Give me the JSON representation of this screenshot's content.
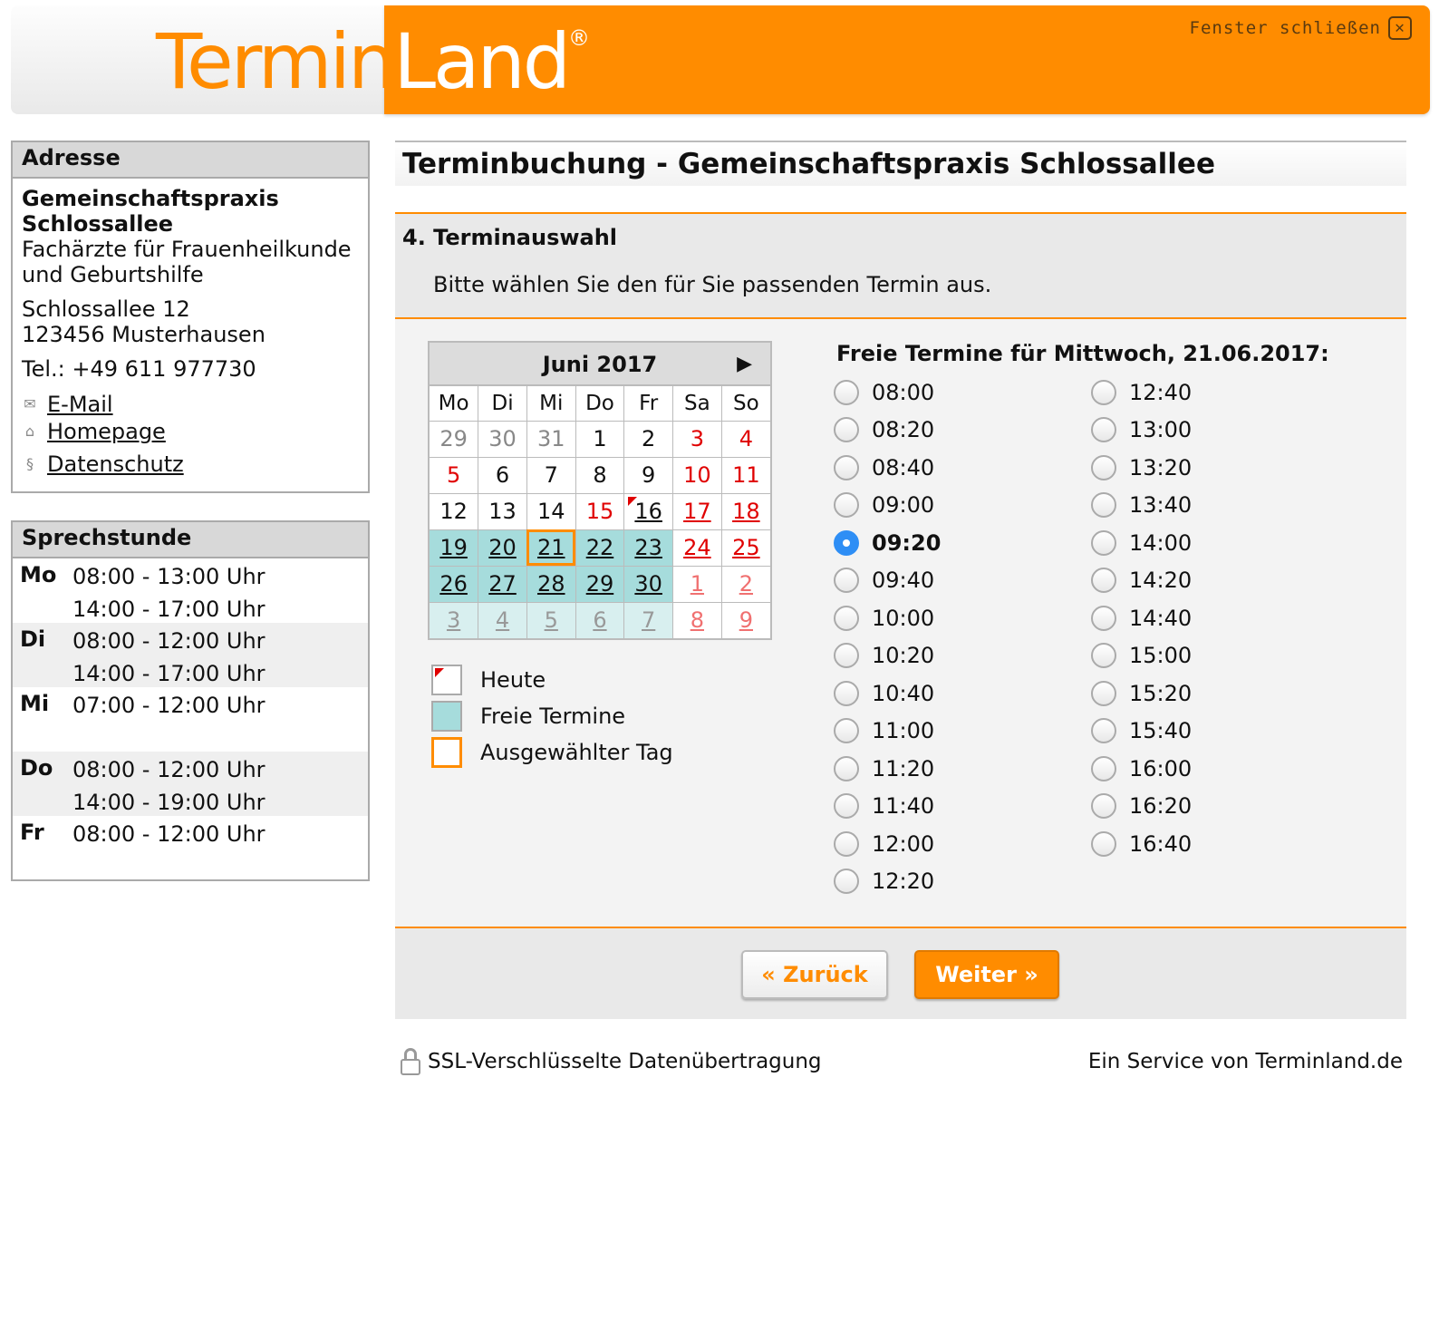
{
  "header": {
    "logo_part1": "Termin",
    "logo_part2": "Land",
    "logo_reg": "®",
    "close_label": "Fenster schließen",
    "close_symbol": "✕",
    "accent_color": "#ff8c00"
  },
  "address": {
    "title": "Adresse",
    "name_line1": "Gemeinschaftspraxis",
    "name_line2": "Schlossallee",
    "specialty_line1": "Fachärzte für Frauenheilkunde",
    "specialty_line2": "und Geburtshilfe",
    "street": "Schlossallee 12",
    "city": "123456 Musterhausen",
    "phone": "Tel.: +49 611 977730",
    "links": [
      {
        "label": "E-Mail",
        "icon": "mail-icon"
      },
      {
        "label": "Homepage",
        "icon": "home-icon"
      },
      {
        "label": "Datenschutz",
        "icon": "paragraph-icon"
      }
    ]
  },
  "hours": {
    "title": "Sprechstunde",
    "days": [
      {
        "day": "Mo",
        "times": [
          "08:00 - 13:00 Uhr",
          "14:00 - 17:00 Uhr"
        ]
      },
      {
        "day": "Di",
        "times": [
          "08:00 - 12:00 Uhr",
          "14:00 - 17:00 Uhr"
        ]
      },
      {
        "day": "Mi",
        "times": [
          "07:00 - 12:00 Uhr",
          ""
        ]
      },
      {
        "day": "Do",
        "times": [
          "08:00 - 12:00 Uhr",
          "14:00 - 19:00 Uhr"
        ]
      },
      {
        "day": "Fr",
        "times": [
          "08:00 - 12:00 Uhr",
          ""
        ]
      }
    ]
  },
  "main": {
    "title": "Terminbuchung - Gemeinschaftspraxis Schlossallee",
    "step_title": "4. Terminauswahl",
    "step_text": "Bitte wählen Sie den für Sie passenden Termin aus."
  },
  "calendar": {
    "month": "Juni 2017",
    "next_symbol": "▶",
    "weekdays": [
      "Mo",
      "Di",
      "Mi",
      "Do",
      "Fr",
      "Sa",
      "So"
    ],
    "weeks": [
      [
        {
          "d": "29",
          "s": "grey"
        },
        {
          "d": "30",
          "s": "grey"
        },
        {
          "d": "31",
          "s": "grey"
        },
        {
          "d": "1",
          "s": "normal"
        },
        {
          "d": "2",
          "s": "normal"
        },
        {
          "d": "3",
          "s": "red"
        },
        {
          "d": "4",
          "s": "red"
        }
      ],
      [
        {
          "d": "5",
          "s": "red"
        },
        {
          "d": "6",
          "s": "normal"
        },
        {
          "d": "7",
          "s": "normal"
        },
        {
          "d": "8",
          "s": "normal"
        },
        {
          "d": "9",
          "s": "normal"
        },
        {
          "d": "10",
          "s": "red"
        },
        {
          "d": "11",
          "s": "red"
        }
      ],
      [
        {
          "d": "12",
          "s": "normal"
        },
        {
          "d": "13",
          "s": "normal"
        },
        {
          "d": "14",
          "s": "normal"
        },
        {
          "d": "15",
          "s": "red"
        },
        {
          "d": "16",
          "s": "today"
        },
        {
          "d": "17",
          "s": "red-link"
        },
        {
          "d": "18",
          "s": "red-link"
        }
      ],
      [
        {
          "d": "19",
          "s": "free"
        },
        {
          "d": "20",
          "s": "free"
        },
        {
          "d": "21",
          "s": "selected"
        },
        {
          "d": "22",
          "s": "free"
        },
        {
          "d": "23",
          "s": "free"
        },
        {
          "d": "24",
          "s": "red-link"
        },
        {
          "d": "25",
          "s": "red-link"
        }
      ],
      [
        {
          "d": "26",
          "s": "free"
        },
        {
          "d": "27",
          "s": "free"
        },
        {
          "d": "28",
          "s": "free"
        },
        {
          "d": "29",
          "s": "free"
        },
        {
          "d": "30",
          "s": "free"
        },
        {
          "d": "1",
          "s": "fade-red"
        },
        {
          "d": "2",
          "s": "fade-red"
        }
      ],
      [
        {
          "d": "3",
          "s": "next-free"
        },
        {
          "d": "4",
          "s": "next-free"
        },
        {
          "d": "5",
          "s": "next-free"
        },
        {
          "d": "6",
          "s": "next-free"
        },
        {
          "d": "7",
          "s": "next-free"
        },
        {
          "d": "8",
          "s": "next-red"
        },
        {
          "d": "9",
          "s": "next-red"
        }
      ]
    ]
  },
  "legend": {
    "today": "Heute",
    "free": "Freie Termine",
    "selected": "Ausgewählter Tag"
  },
  "times": {
    "title": "Freie Termine für Mittwoch, 21.06.2017:",
    "selected": "09:20",
    "col1": [
      "08:00",
      "08:20",
      "08:40",
      "09:00",
      "09:20",
      "09:40",
      "10:00",
      "10:20",
      "10:40",
      "11:00",
      "11:20",
      "11:40",
      "12:00",
      "12:20"
    ],
    "col2": [
      "12:40",
      "13:00",
      "13:20",
      "13:40",
      "14:00",
      "14:20",
      "14:40",
      "15:00",
      "15:20",
      "15:40",
      "16:00",
      "16:20",
      "16:40"
    ]
  },
  "nav": {
    "back": "« Zurück",
    "next": "Weiter »"
  },
  "footer": {
    "ssl": "SSL-Verschlüsselte Datenübertragung",
    "service": "Ein Service von Terminland.de"
  }
}
